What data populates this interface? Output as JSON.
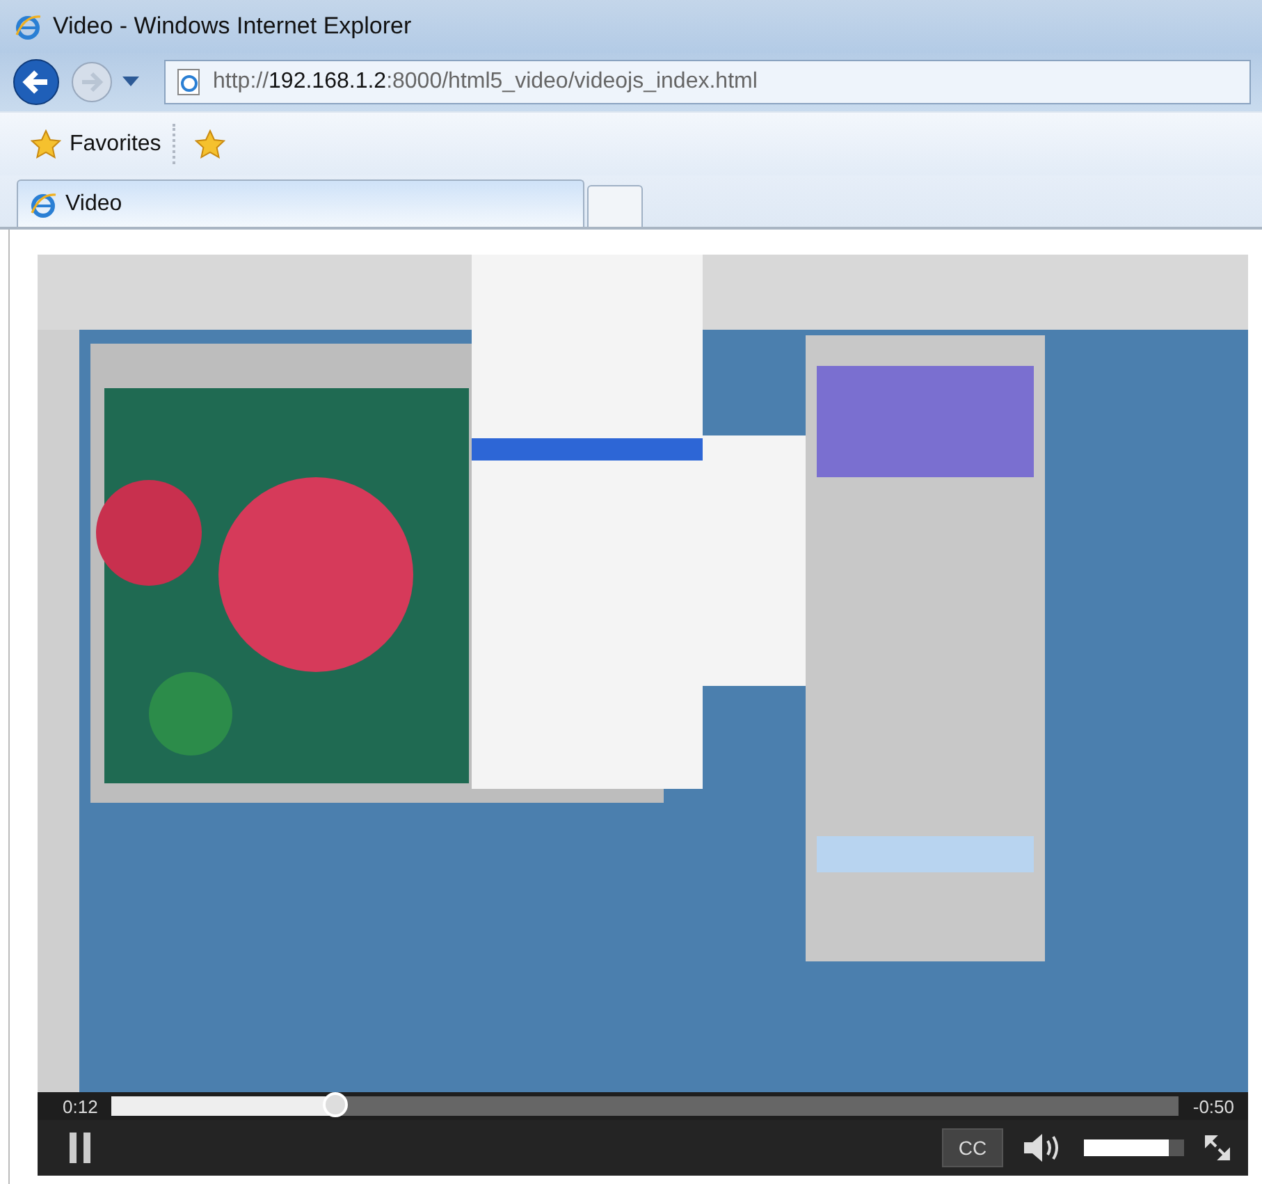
{
  "window": {
    "title": "Video - Windows Internet Explorer"
  },
  "address_bar": {
    "segments": [
      {
        "text": "http://",
        "emphasis": false
      },
      {
        "text": "192.168.1.2",
        "emphasis": true
      },
      {
        "text": ":8000/html5_video/videojs_index.html",
        "emphasis": false
      }
    ]
  },
  "favorites_bar": {
    "label": "Favorites"
  },
  "tabs": [
    {
      "label": "Video",
      "selected": true
    }
  ],
  "video_player": {
    "playing": true,
    "current_time": "0:12",
    "remaining_time": "-0:50",
    "progress": {
      "level": 0.21
    },
    "captions_button": "CC",
    "volume": {
      "level": 0.85
    }
  }
}
